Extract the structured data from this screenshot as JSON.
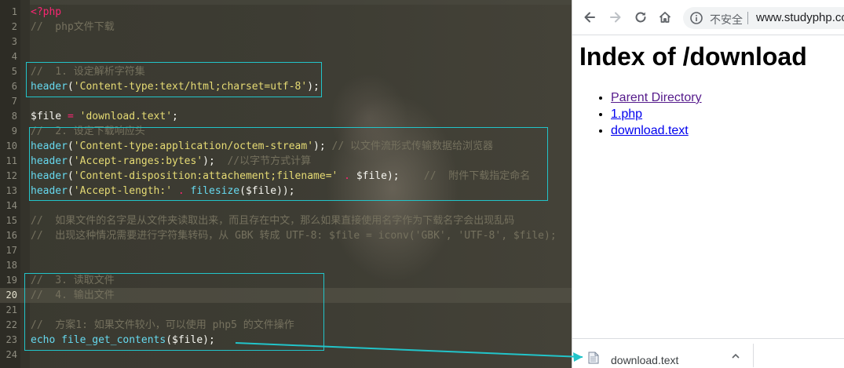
{
  "editor": {
    "lines": [
      {
        "n": "1",
        "parts": [
          [
            "kw",
            "<?php"
          ]
        ]
      },
      {
        "n": "2",
        "parts": [
          [
            "cm",
            "//  php文件下载"
          ]
        ]
      },
      {
        "n": "3",
        "parts": []
      },
      {
        "n": "4",
        "parts": []
      },
      {
        "n": "5",
        "parts": [
          [
            "cm",
            "//  1. 设定解析字符集"
          ]
        ]
      },
      {
        "n": "6",
        "parts": [
          [
            "fn",
            "header"
          ],
          [
            "pl",
            "("
          ],
          [
            "st",
            "'Content-type:text/html;charset=utf-8'"
          ],
          [
            "pl",
            ");"
          ]
        ]
      },
      {
        "n": "7",
        "parts": []
      },
      {
        "n": "8",
        "parts": [
          [
            "var",
            "$file"
          ],
          [
            "pl",
            " "
          ],
          [
            "op",
            "="
          ],
          [
            "pl",
            " "
          ],
          [
            "st",
            "'download.text'"
          ],
          [
            "pl",
            ";"
          ]
        ]
      },
      {
        "n": "9",
        "parts": [
          [
            "cm",
            "//  2. 设定下载响应头"
          ]
        ]
      },
      {
        "n": "10",
        "parts": [
          [
            "fn",
            "header"
          ],
          [
            "pl",
            "("
          ],
          [
            "st",
            "'Content-type:application/octem-stream'"
          ],
          [
            "pl",
            "); "
          ],
          [
            "cm",
            "// 以文件流形式传输数据给浏览器"
          ]
        ]
      },
      {
        "n": "11",
        "parts": [
          [
            "fn",
            "header"
          ],
          [
            "pl",
            "("
          ],
          [
            "st",
            "'Accept-ranges:bytes'"
          ],
          [
            "pl",
            ");  "
          ],
          [
            "cm",
            "//以字节方式计算"
          ]
        ]
      },
      {
        "n": "12",
        "parts": [
          [
            "fn",
            "header"
          ],
          [
            "pl",
            "("
          ],
          [
            "st",
            "'Content-disposition:attachement;filename='"
          ],
          [
            "pl",
            " "
          ],
          [
            "op",
            "."
          ],
          [
            "pl",
            " $file);    "
          ],
          [
            "cm",
            "//  附件下载指定命名"
          ]
        ]
      },
      {
        "n": "13",
        "parts": [
          [
            "fn",
            "header"
          ],
          [
            "pl",
            "("
          ],
          [
            "st",
            "'Accept-length:'"
          ],
          [
            "pl",
            " "
          ],
          [
            "op",
            "."
          ],
          [
            "pl",
            " "
          ],
          [
            "fn",
            "filesize"
          ],
          [
            "pl",
            "($file));"
          ]
        ]
      },
      {
        "n": "14",
        "parts": []
      },
      {
        "n": "15",
        "parts": [
          [
            "cm",
            "//  如果文件的名字是从文件夹读取出来，而且存在中文，那么如果直接使用名字作为下载名字会出现乱码"
          ]
        ]
      },
      {
        "n": "16",
        "parts": [
          [
            "cm",
            "//  出现这种情况需要进行字符集转码，从 GBK 转成 UTF-8: $file = iconv('GBK', 'UTF-8', $file);"
          ]
        ]
      },
      {
        "n": "17",
        "parts": []
      },
      {
        "n": "18",
        "parts": []
      },
      {
        "n": "19",
        "parts": [
          [
            "cm",
            "//  3. 读取文件"
          ]
        ]
      },
      {
        "n": "20",
        "parts": [
          [
            "cm",
            "//  4. 输出文件"
          ]
        ]
      },
      {
        "n": "21",
        "parts": []
      },
      {
        "n": "22",
        "parts": [
          [
            "cm",
            "//  方案1: 如果文件较小，可以使用 php5 的文件操作"
          ]
        ]
      },
      {
        "n": "23",
        "parts": [
          [
            "fn",
            "echo"
          ],
          [
            "pl",
            " "
          ],
          [
            "fn",
            "file_get_contents"
          ],
          [
            "pl",
            "($file);"
          ]
        ]
      },
      {
        "n": "24",
        "parts": []
      }
    ],
    "current_line": "20"
  },
  "browser": {
    "security_label": "不安全",
    "url": "www.studyphp.com",
    "heading": "Index of /download",
    "links": [
      {
        "label": "Parent Directory",
        "visited": true
      },
      {
        "label": "1.php",
        "visited": false
      },
      {
        "label": "download.text",
        "visited": false
      }
    ],
    "download_filename": "download.text"
  },
  "colors": {
    "annotation": "#22c4c9",
    "link": "#0000ee",
    "visited_link": "#551a8b"
  }
}
